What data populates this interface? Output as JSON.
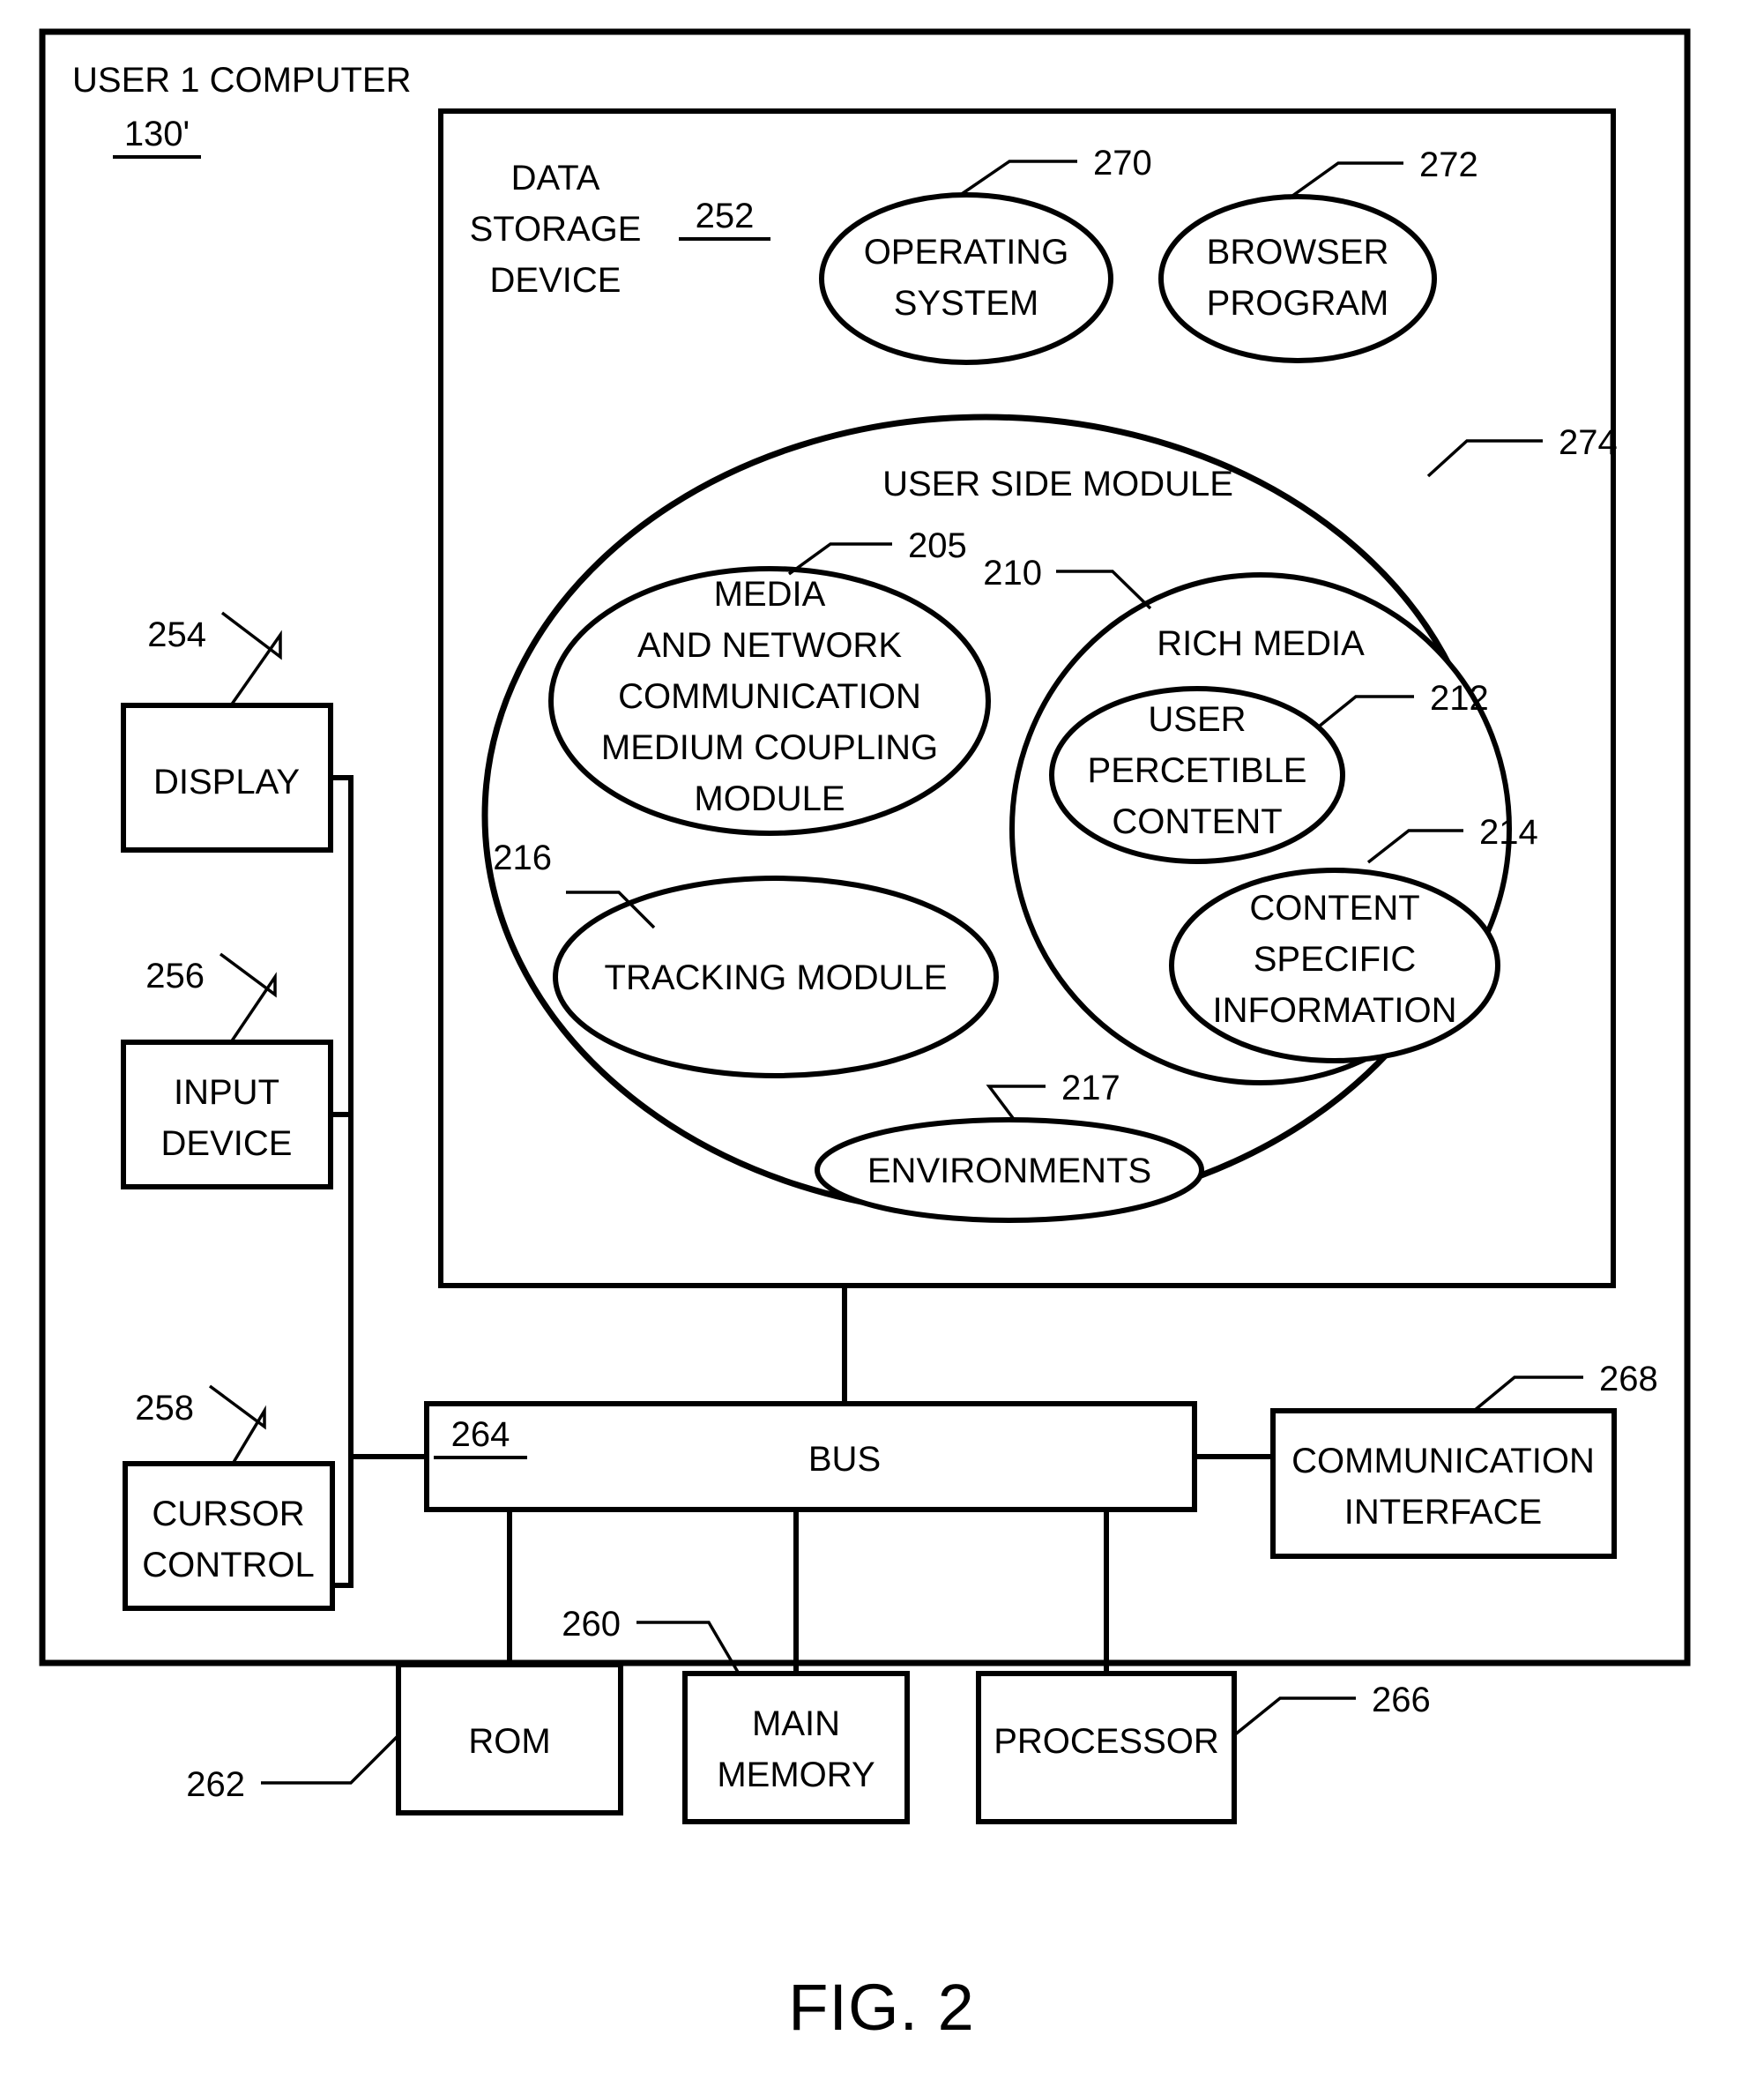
{
  "figure": {
    "caption": "FIG. 2",
    "outer_title": "USER 1 COMPUTER",
    "outer_ref": "130'"
  },
  "data_storage": {
    "title_line1": "DATA",
    "title_line2": "STORAGE",
    "title_line3": "DEVICE",
    "ref": "252"
  },
  "ovals": {
    "operating_system": {
      "line1": "OPERATING",
      "line2": "SYSTEM",
      "ref": "270"
    },
    "browser_program": {
      "line1": "BROWSER",
      "line2": "PROGRAM",
      "ref": "272"
    },
    "user_side_module": {
      "label": "USER SIDE MODULE",
      "ref": "274"
    },
    "media_network": {
      "line1": "MEDIA",
      "line2": "AND NETWORK",
      "line3": "COMMUNICATION",
      "line4": "MEDIUM COUPLING",
      "line5": "MODULE",
      "ref": "205"
    },
    "rich_media": {
      "label": "RICH MEDIA",
      "ref": "210"
    },
    "user_perceptible_content": {
      "line1": "USER",
      "line2": "PERCETIBLE",
      "line3": "CONTENT",
      "ref": "212"
    },
    "content_specific_information": {
      "line1": "CONTENT",
      "line2": "SPECIFIC",
      "line3": "INFORMATION",
      "ref": "214"
    },
    "tracking_module": {
      "label": "TRACKING MODULE",
      "ref": "216"
    },
    "environments": {
      "label": "ENVIRONMENTS",
      "ref": "217"
    }
  },
  "boxes": {
    "display": {
      "label": "DISPLAY",
      "ref": "254"
    },
    "input_device": {
      "line1": "INPUT",
      "line2": "DEVICE",
      "ref": "256"
    },
    "cursor_control": {
      "line1": "CURSOR",
      "line2": "CONTROL",
      "ref": "258"
    },
    "bus": {
      "label": "BUS",
      "ref": "264"
    },
    "communication_interface": {
      "line1": "COMMUNICATION",
      "line2": "INTERFACE",
      "ref": "268"
    },
    "rom": {
      "label": "ROM",
      "ref": "262"
    },
    "main_memory": {
      "line1": "MAIN",
      "line2": "MEMORY",
      "ref": "260"
    },
    "processor": {
      "label": "PROCESSOR",
      "ref": "266"
    }
  },
  "colors": {
    "ink": "#000000",
    "paper": "#ffffff"
  }
}
